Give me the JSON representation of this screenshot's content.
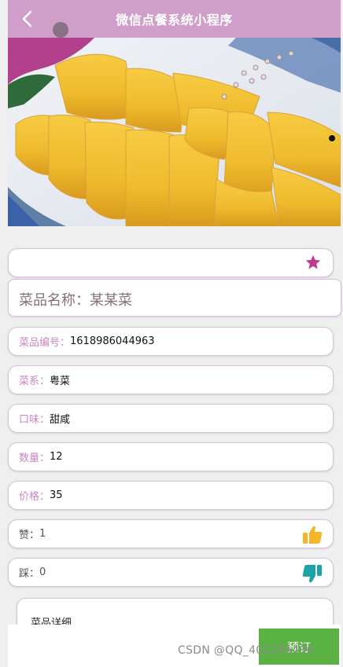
{
  "header": {
    "title": "微信点餐系统小程序",
    "back_icon": "chevron-left-icon"
  },
  "hero": {
    "alt_subject": "food-photo"
  },
  "favorite": {
    "icon": "star-icon",
    "color": "#c2378f"
  },
  "dish": {
    "name_label": "菜品名称：",
    "name_value": "某某菜"
  },
  "fields": [
    {
      "label": "菜品编号：",
      "value": "1618986044963"
    },
    {
      "label": "菜系：",
      "value": "粤菜"
    },
    {
      "label": "口味：",
      "value": "甜咸"
    },
    {
      "label": "数量：",
      "value": "12"
    },
    {
      "label": "价格：",
      "value": "35"
    }
  ],
  "likes": {
    "label": "赞：",
    "value": "1",
    "icon": "thumbs-up-icon",
    "color": "#f3b62a"
  },
  "dislikes": {
    "label": "踩：",
    "value": "0",
    "icon": "thumbs-down-icon",
    "color": "#1aa3a6"
  },
  "detail": {
    "label": "菜品详细"
  },
  "order_button": {
    "label": "预订"
  },
  "watermark": "CSDN @QQ_402265496"
}
